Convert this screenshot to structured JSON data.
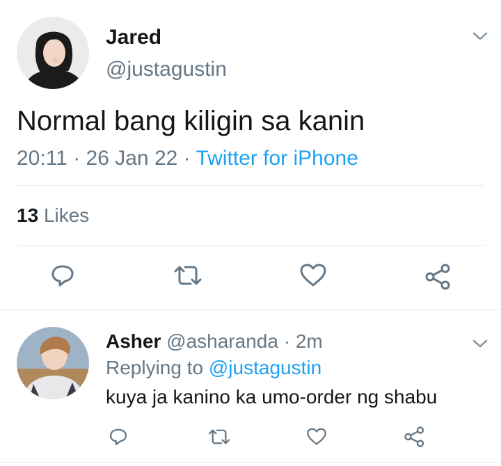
{
  "tweet": {
    "author_name": "Jared",
    "author_handle": "@justagustin",
    "text": "Normal bang kiligin sa kanin",
    "time": "20:11",
    "date": "26 Jan 22",
    "separator": "·",
    "source": "Twitter for iPhone",
    "likes_count": "13",
    "likes_label": "Likes"
  },
  "reply": {
    "author_name": "Asher",
    "author_handle": "@asharanda",
    "time_ago": "2m",
    "separator": "·",
    "replying_prefix": "Replying to",
    "replying_handle": "@justagustin",
    "text": "kuya ja kanino ka umo-order ng shabu"
  },
  "icons": {
    "caret": "chevron-down-icon",
    "reply": "reply-icon",
    "retweet": "retweet-icon",
    "like": "heart-icon",
    "share": "share-icon"
  },
  "colors": {
    "text": "#14171a",
    "muted": "#657786",
    "link": "#1da1f2",
    "divider": "#e1e8ed"
  }
}
